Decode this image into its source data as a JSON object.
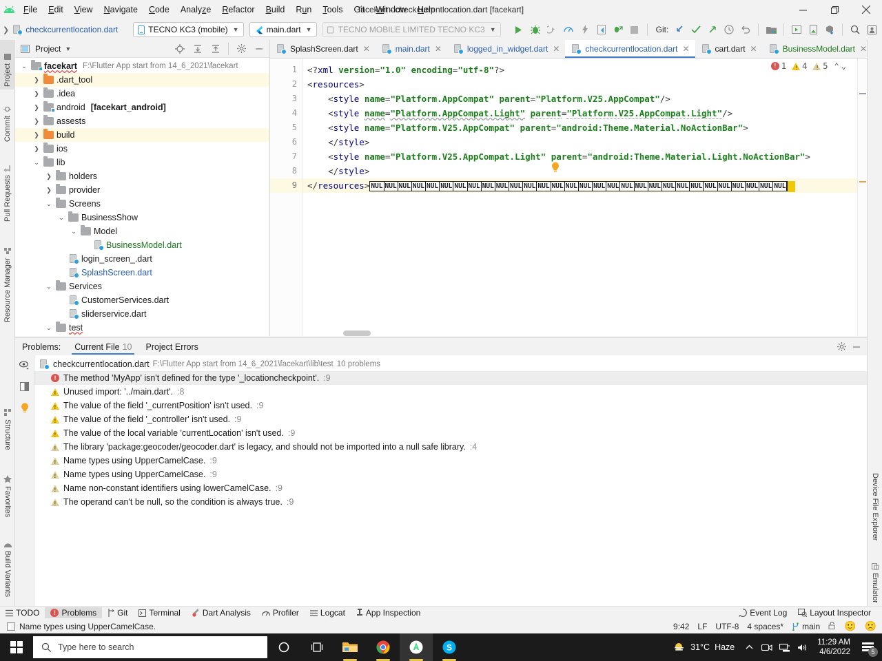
{
  "window": {
    "title": "facekart - checkcurrentlocation.dart [facekart]",
    "minimize": "—",
    "maximize": "❐",
    "close": "✕"
  },
  "menu": [
    "File",
    "Edit",
    "View",
    "Navigate",
    "Code",
    "Analyze",
    "Refactor",
    "Build",
    "Run",
    "Tools",
    "Git",
    "Window",
    "Help"
  ],
  "navbar": {
    "breadcrumb_file": "checkcurrentlocation.dart",
    "device_combo": "TECNO KC3 (mobile)",
    "config_combo": "main.dart",
    "target_combo": "TECNO MOBILE LIMITED TECNO KC3",
    "git_label": "Git:"
  },
  "left_tools": [
    {
      "label": "Project",
      "icon": "project-icon",
      "active": true
    },
    {
      "label": "Commit",
      "icon": "commit-icon",
      "active": false
    },
    {
      "label": "Pull Requests",
      "icon": "pull-request-icon",
      "active": false
    },
    {
      "label": "Resource Manager",
      "icon": "resource-manager-icon",
      "active": false
    },
    {
      "label": "Structure",
      "icon": "structure-icon",
      "active": false
    },
    {
      "label": "Favorites",
      "icon": "star-icon",
      "active": false
    },
    {
      "label": "Build Variants",
      "icon": "android-icon",
      "active": false
    }
  ],
  "right_tools": [
    {
      "label": "Device File Explorer",
      "icon": "device-file-explorer-icon"
    },
    {
      "label": "Emulator",
      "icon": "emulator-icon"
    }
  ],
  "project": {
    "title": "Project",
    "root": {
      "name": "facekart",
      "path": "F:\\Flutter App start from  14_6_2021\\facekart"
    },
    "items": [
      {
        "name": ".dart_tool",
        "indent": 1,
        "arrow": "right",
        "type": "folder-orange",
        "highlight": true
      },
      {
        "name": ".idea",
        "indent": 1,
        "arrow": "right",
        "type": "folder",
        "highlight": false
      },
      {
        "name": "android",
        "indent": 1,
        "arrow": "right",
        "type": "folder-module",
        "highlight": false,
        "suffix": "[facekart_android]"
      },
      {
        "name": "assests",
        "indent": 1,
        "arrow": "right",
        "type": "folder",
        "highlight": false
      },
      {
        "name": "build",
        "indent": 1,
        "arrow": "right",
        "type": "folder-build",
        "highlight": true
      },
      {
        "name": "ios",
        "indent": 1,
        "arrow": "right",
        "type": "folder",
        "highlight": false
      },
      {
        "name": "lib",
        "indent": 1,
        "arrow": "down",
        "type": "folder",
        "highlight": false
      },
      {
        "name": "holders",
        "indent": 2,
        "arrow": "right",
        "type": "folder",
        "highlight": false
      },
      {
        "name": "provider",
        "indent": 2,
        "arrow": "right",
        "type": "folder",
        "highlight": false
      },
      {
        "name": "Screens",
        "indent": 2,
        "arrow": "down",
        "type": "folder",
        "highlight": false
      },
      {
        "name": "BusinessShow",
        "indent": 3,
        "arrow": "down",
        "type": "folder",
        "highlight": false
      },
      {
        "name": "Model",
        "indent": 4,
        "arrow": "down",
        "type": "folder",
        "highlight": false
      },
      {
        "name": "BusinessModel.dart",
        "indent": 5,
        "arrow": "none",
        "type": "dart",
        "color": "green",
        "highlight": false
      },
      {
        "name": "login_screen_.dart",
        "indent": 3,
        "arrow": "none",
        "type": "dart",
        "color": "plain",
        "highlight": false
      },
      {
        "name": "SplashScreen.dart",
        "indent": 3,
        "arrow": "none",
        "type": "dart",
        "color": "blue",
        "highlight": false
      },
      {
        "name": "Services",
        "indent": 2,
        "arrow": "down",
        "type": "folder",
        "highlight": false
      },
      {
        "name": "CustomerServices.dart",
        "indent": 3,
        "arrow": "none",
        "type": "dart",
        "color": "plain",
        "highlight": false
      },
      {
        "name": "sliderservice.dart",
        "indent": 3,
        "arrow": "none",
        "type": "dart",
        "color": "plain",
        "highlight": false
      },
      {
        "name": "test",
        "indent": 2,
        "arrow": "down",
        "type": "folder",
        "highlight": false
      }
    ]
  },
  "editor": {
    "tabs": [
      {
        "label": "SplashScreen.dart",
        "color": "plain",
        "active": false
      },
      {
        "label": "main.dart",
        "color": "blue",
        "active": false
      },
      {
        "label": "logged_in_widget.dart",
        "color": "blue",
        "active": false
      },
      {
        "label": "checkcurrentlocation.dart",
        "color": "blue",
        "active": true
      },
      {
        "label": "cart.dart",
        "color": "plain",
        "active": false
      },
      {
        "label": "BusinessModel.dart",
        "color": "green",
        "active": false
      }
    ],
    "inspection": {
      "errors": "1",
      "warnings": "4",
      "weak_warnings": "5"
    },
    "lines": [
      {
        "n": "1",
        "text": "<?xml version=\"1.0\" encoding=\"utf-8\"?>"
      },
      {
        "n": "2",
        "text": "<resources>"
      },
      {
        "n": "3",
        "text": "    <style name=\"Platform.AppCompat\" parent=\"Platform.V25.AppCompat\"/>"
      },
      {
        "n": "4",
        "text": "    <style name=\"Platform.AppCompat.Light\" parent=\"Platform.V25.AppCompat.Light\"/>"
      },
      {
        "n": "5",
        "text": "    <style name=\"Platform.V25.AppCompat\" parent=\"android:Theme.Material.NoActionBar\">"
      },
      {
        "n": "6",
        "text": "    </style>"
      },
      {
        "n": "7",
        "text": "    <style name=\"Platform.V25.AppCompat.Light\" parent=\"android:Theme.Material.Light.NoActionBar\">"
      },
      {
        "n": "8",
        "text": "    </style>"
      },
      {
        "n": "9",
        "text": "</resources>"
      }
    ],
    "nul_token": "NUL",
    "nul_count": 30
  },
  "problems": {
    "label": "Problems:",
    "tabs": [
      {
        "label": "Current File",
        "count": "10",
        "active": true
      },
      {
        "label": "Project Errors",
        "count": "",
        "active": false
      }
    ],
    "file": {
      "name": "checkcurrentlocation.dart",
      "path": "F:\\Flutter App start from  14_6_2021\\facekart\\lib\\test",
      "count": "10 problems"
    },
    "rows": [
      {
        "severity": "error",
        "text": "The method 'MyApp' isn't defined for the type '_locationcheckpoint'.",
        "line": ":9",
        "selected": true
      },
      {
        "severity": "warning",
        "text": "Unused import: '../main.dart'.",
        "line": ":8",
        "selected": false
      },
      {
        "severity": "warning",
        "text": "The value of the field '_currentPosition' isn't used.",
        "line": ":9",
        "selected": false
      },
      {
        "severity": "warning",
        "text": "The value of the field '_controller' isn't used.",
        "line": ":9",
        "selected": false
      },
      {
        "severity": "warning",
        "text": "The value of the local variable 'currentLocation' isn't used.",
        "line": ":9",
        "selected": false
      },
      {
        "severity": "weak",
        "text": "The library 'package:geocoder/geocoder.dart' is legacy, and should not be imported into a null safe library.",
        "line": ":4",
        "selected": false
      },
      {
        "severity": "weak",
        "text": "Name types using UpperCamelCase.",
        "line": ":9",
        "selected": false
      },
      {
        "severity": "weak",
        "text": "Name types using UpperCamelCase.",
        "line": ":9",
        "selected": false
      },
      {
        "severity": "weak",
        "text": "Name non-constant identifiers using lowerCamelCase.",
        "line": ":9",
        "selected": false
      },
      {
        "severity": "weak",
        "text": "The operand can't be null, so the condition is always true.",
        "line": ":9",
        "selected": false
      }
    ]
  },
  "bottom_bar": {
    "items": [
      {
        "label": "TODO",
        "icon": "todo-icon",
        "active": false
      },
      {
        "label": "Problems",
        "icon": "problems-icon",
        "active": true
      },
      {
        "label": "Git",
        "icon": "git-icon",
        "active": false
      },
      {
        "label": "Terminal",
        "icon": "terminal-icon",
        "active": false
      },
      {
        "label": "Dart Analysis",
        "icon": "dart-icon",
        "active": false
      },
      {
        "label": "Profiler",
        "icon": "profiler-icon",
        "active": false
      },
      {
        "label": "Logcat",
        "icon": "logcat-icon",
        "active": false
      },
      {
        "label": "App Inspection",
        "icon": "app-inspection-icon",
        "active": false
      }
    ],
    "right": [
      {
        "label": "Event Log",
        "icon": "event-log-icon"
      },
      {
        "label": "Layout Inspector",
        "icon": "layout-inspector-icon"
      }
    ]
  },
  "statusbar": {
    "message": "Name types using UpperCamelCase.",
    "caret": "9:42",
    "line_sep": "LF",
    "encoding": "UTF-8",
    "indent": "4 spaces*",
    "branch": "main"
  },
  "taskbar": {
    "search_placeholder": "Type here to search",
    "weather_temp": "31°C",
    "weather_desc": "Haze",
    "time": "11:29 AM",
    "date": "4/6/2022",
    "notification_count": "5"
  },
  "colors": {
    "accent": "#3d7eca",
    "error": "#d9534f",
    "warning": "#f0c419",
    "green": "#1f7a1f",
    "taskbar": "#1b1b1b"
  }
}
